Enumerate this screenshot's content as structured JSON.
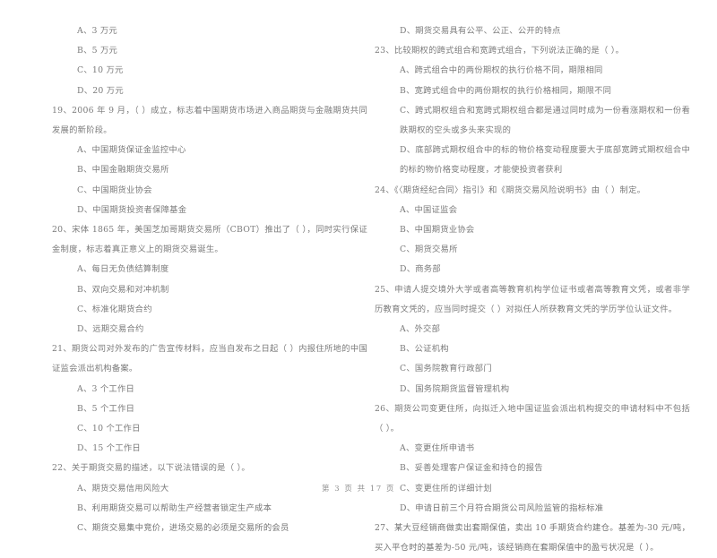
{
  "document": {
    "type": "exam-paper",
    "page_footer": "第 3 页  共 17 页",
    "text_color": "#737373",
    "background_color": "#ffffff"
  },
  "left_column": {
    "items": [
      {
        "kind": "option",
        "text": "A、3 万元"
      },
      {
        "kind": "option",
        "text": "B、5 万元"
      },
      {
        "kind": "option",
        "text": "C、10 万元"
      },
      {
        "kind": "option",
        "text": "D、20 万元"
      },
      {
        "kind": "question",
        "text": "19、2006 年 9 月，（      ）成立，标志着中国期货市场进入商品期货与金融期货共同发展的新阶段。"
      },
      {
        "kind": "option",
        "text": "A、中国期货保证金监控中心"
      },
      {
        "kind": "option",
        "text": "B、中国金融期货交易所"
      },
      {
        "kind": "option",
        "text": "C、中国期货业协会"
      },
      {
        "kind": "option",
        "text": "D、中国期货投资者保障基金"
      },
      {
        "kind": "question",
        "text": "20、宋体 1865 年，美国芝加哥期货交易所（CBOT）推出了（      ），同时实行保证金制度，标志着真正意义上的期货交易诞生。"
      },
      {
        "kind": "option",
        "text": "A、每日无负债结算制度"
      },
      {
        "kind": "option",
        "text": "B、双向交易和对冲机制"
      },
      {
        "kind": "option",
        "text": "C、标准化期货合约"
      },
      {
        "kind": "option",
        "text": "D、远期交易合约"
      },
      {
        "kind": "question",
        "text": "21、期货公司对外发布的广告宣传材料，应当自发布之日起（      ）内报住所地的中国证监会派出机构备案。"
      },
      {
        "kind": "option",
        "text": "A、3 个工作日"
      },
      {
        "kind": "option",
        "text": "B、5 个工作日"
      },
      {
        "kind": "option",
        "text": "C、10 个工作日"
      },
      {
        "kind": "option",
        "text": "D、15 个工作日"
      },
      {
        "kind": "question",
        "text": "22、关于期货交易的描述，以下说法错误的是（      ）。"
      },
      {
        "kind": "option",
        "text": "A、期货交易信用风险大"
      },
      {
        "kind": "option",
        "text": "B、利用期货交易可以帮助生产经营者锁定生产成本"
      },
      {
        "kind": "option",
        "text": "C、期货交易集中竞价，进场交易的必须是交易所的会员"
      }
    ]
  },
  "right_column": {
    "items": [
      {
        "kind": "option",
        "text": "D、期货交易具有公平、公正、公开的特点"
      },
      {
        "kind": "question",
        "text": "23、比较期权的跨式组合和宽跨式组合，下列说法正确的是（      ）。"
      },
      {
        "kind": "option",
        "text": "A、跨式组合中的两份期权的执行价格不同，期限相同"
      },
      {
        "kind": "option",
        "text": "B、宽跨式组合中的两份期权的执行价格相同，期限不同"
      },
      {
        "kind": "option",
        "text": "C、跨式期权组合和宽跨式期权组合都是通过同时成为一份看涨期权和一份看跌期权的空头或多头来实现的"
      },
      {
        "kind": "option",
        "text": "D、底部跨式期权组合中的标的物价格变动程度要大于底部宽跨式期权组合中的标的物价格变动程度，才能使投资者获利"
      },
      {
        "kind": "question",
        "text": "24、《〈期货经纪合同〉指引》和《期货交易风险说明书》由（      ）制定。"
      },
      {
        "kind": "option",
        "text": "A、中国证监会"
      },
      {
        "kind": "option",
        "text": "B、中国期货业协会"
      },
      {
        "kind": "option",
        "text": "C、期货交易所"
      },
      {
        "kind": "option",
        "text": "D、商务部"
      },
      {
        "kind": "question",
        "text": "25、申请人提交境外大学或者高等教育机构学位证书或者高等教育文凭，或者非学历教育文凭的，应当同时提交（      ）对拟任人所获教育文凭的学历学位认证文件。"
      },
      {
        "kind": "option",
        "text": "A、外交部"
      },
      {
        "kind": "option",
        "text": "B、公证机构"
      },
      {
        "kind": "option",
        "text": "C、国务院教育行政部门"
      },
      {
        "kind": "option",
        "text": "D、国务院期货监督管理机构"
      },
      {
        "kind": "question",
        "text": "26、期货公司变更住所，向拟迁入地中国证监会派出机构提交的申请材料中不包括（      ）。"
      },
      {
        "kind": "option",
        "text": "A、变更住所申请书"
      },
      {
        "kind": "option",
        "text": "B、妥善处理客户保证金和持仓的报告"
      },
      {
        "kind": "option",
        "text": "C、变更住所的详细计划"
      },
      {
        "kind": "option",
        "text": "D、申请日前三个月符合期货公司风险监管的指标标准"
      },
      {
        "kind": "question",
        "text": "27、某大豆经销商做卖出套期保值，卖出 10 手期货合约建仓。基差为-30 元/吨，买入平仓时的基差为-50 元/吨，该经销商在套期保值中的盈亏状况是（      ）。"
      }
    ]
  }
}
